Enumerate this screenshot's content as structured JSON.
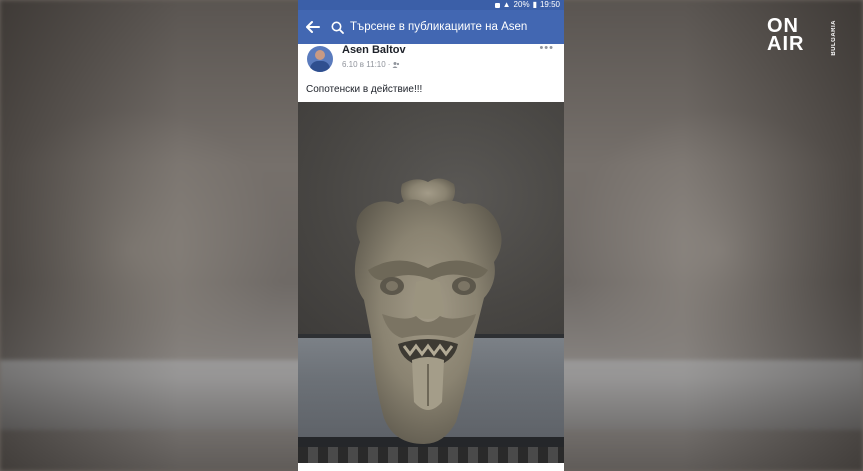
{
  "broadcaster": {
    "logo_top": "ON",
    "logo_bottom": "AIR",
    "logo_country": "BULGARIA"
  },
  "statusbar": {
    "battery": "20%",
    "time": "19:50"
  },
  "navbar": {
    "back_icon": "arrow-left-icon",
    "search_placeholder": "Търсене в публикациите на Asen"
  },
  "post": {
    "author": "Asen Baltov",
    "timestamp": "6.10 в 11:10",
    "privacy_icon": "friends-icon",
    "text": "Сопотенски в действие!!!"
  },
  "colors": {
    "facebook_blue": "#4267b2",
    "status_blue": "#3b5fa8"
  }
}
